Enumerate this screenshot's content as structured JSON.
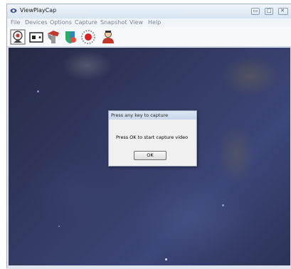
{
  "window": {
    "title": "ViewPlayCap",
    "icon": "app-eye-icon"
  },
  "window_controls": [
    {
      "name": "minimize-button",
      "icon": "minimize-icon",
      "glyph": "▭"
    },
    {
      "name": "maximize-button",
      "icon": "maximize-icon",
      "glyph": "□"
    },
    {
      "name": "close-button",
      "icon": "close-icon",
      "glyph": "✕"
    }
  ],
  "menu": [
    "File",
    "Devices",
    "Options",
    "Capture",
    "Snapshot",
    "View",
    "Help"
  ],
  "toolbar": [
    {
      "name": "webcam-icon"
    },
    {
      "name": "video-display-icon"
    },
    {
      "name": "camera-capture-icon"
    },
    {
      "name": "shield-settings-icon"
    },
    {
      "name": "record-icon"
    },
    {
      "name": "user-icon"
    }
  ],
  "dialog": {
    "title": "Press any key to capture",
    "message": "Press OK to start capture video",
    "ok_label": "OK"
  },
  "colors": {
    "titlebar": "#d7e4f2",
    "viewport": "#333a62",
    "dialog_bg": "#f0f0f0"
  }
}
